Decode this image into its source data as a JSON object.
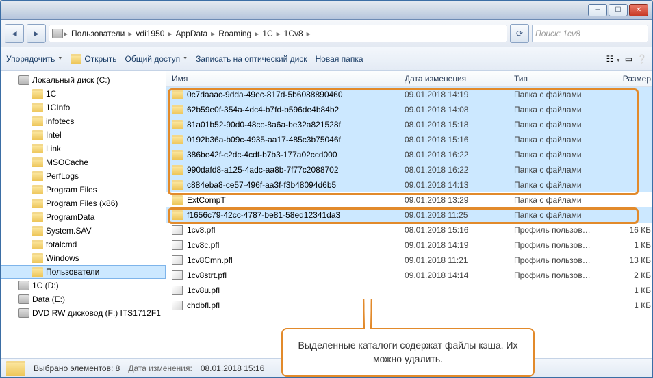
{
  "breadcrumbs": [
    "Пользователи",
    "vdi1950",
    "AppData",
    "Roaming",
    "1C",
    "1Cv8"
  ],
  "search_placeholder": "Поиск: 1cv8",
  "toolbar": {
    "organize": "Упорядочить",
    "open": "Открыть",
    "share": "Общий доступ",
    "burn": "Записать на оптический диск",
    "newfolder": "Новая папка"
  },
  "tree": [
    {
      "label": "Локальный диск (C:)",
      "icon": "drive",
      "depth": 0
    },
    {
      "label": "1C",
      "icon": "folder",
      "depth": 1
    },
    {
      "label": "1CInfo",
      "icon": "folder",
      "depth": 1
    },
    {
      "label": "infotecs",
      "icon": "folder",
      "depth": 1
    },
    {
      "label": "Intel",
      "icon": "folder",
      "depth": 1
    },
    {
      "label": "Link",
      "icon": "folder",
      "depth": 1
    },
    {
      "label": "MSOCache",
      "icon": "folder",
      "depth": 1
    },
    {
      "label": "PerfLogs",
      "icon": "folder",
      "depth": 1
    },
    {
      "label": "Program Files",
      "icon": "folder",
      "depth": 1
    },
    {
      "label": "Program Files (x86)",
      "icon": "folder",
      "depth": 1
    },
    {
      "label": "ProgramData",
      "icon": "folder",
      "depth": 1
    },
    {
      "label": "System.SAV",
      "icon": "folder",
      "depth": 1
    },
    {
      "label": "totalcmd",
      "icon": "folder",
      "depth": 1
    },
    {
      "label": "Windows",
      "icon": "folder",
      "depth": 1
    },
    {
      "label": "Пользователи",
      "icon": "folder",
      "depth": 1,
      "selected": true
    },
    {
      "label": "1C (D:)",
      "icon": "drive",
      "depth": 0
    },
    {
      "label": "Data (E:)",
      "icon": "drive",
      "depth": 0
    },
    {
      "label": "DVD RW дисковод (F:) ITS1712F1",
      "icon": "drive",
      "depth": 0
    }
  ],
  "columns": {
    "name": "Имя",
    "date": "Дата изменения",
    "type": "Тип",
    "size": "Размер"
  },
  "rows": [
    {
      "name": "0c7daaac-9dda-49ec-817d-5b6088890460",
      "date": "09.01.2018 14:19",
      "type": "Папка с файлами",
      "size": "",
      "icon": "folder",
      "sel": true
    },
    {
      "name": "62b59e0f-354a-4dc4-b7fd-b596de4b84b2",
      "date": "09.01.2018 14:08",
      "type": "Папка с файлами",
      "size": "",
      "icon": "folder",
      "sel": true
    },
    {
      "name": "81a01b52-90d0-48cc-8a6a-be32a821528f",
      "date": "08.01.2018 15:18",
      "type": "Папка с файлами",
      "size": "",
      "icon": "folder",
      "sel": true
    },
    {
      "name": "0192b36a-b09c-4935-aa17-485c3b75046f",
      "date": "08.01.2018 15:16",
      "type": "Папка с файлами",
      "size": "",
      "icon": "folder",
      "sel": true
    },
    {
      "name": "386be42f-c2dc-4cdf-b7b3-177a02ccd000",
      "date": "08.01.2018 16:22",
      "type": "Папка с файлами",
      "size": "",
      "icon": "folder",
      "sel": true
    },
    {
      "name": "990dafd8-a125-4adc-aa8b-7f77c2088702",
      "date": "08.01.2018 16:22",
      "type": "Папка с файлами",
      "size": "",
      "icon": "folder",
      "sel": true
    },
    {
      "name": "c884eba8-ce57-496f-aa3f-f3b48094d6b5",
      "date": "09.01.2018 14:13",
      "type": "Папка с файлами",
      "size": "",
      "icon": "folder",
      "sel": true
    },
    {
      "name": "ExtCompT",
      "date": "09.01.2018 13:29",
      "type": "Папка с файлами",
      "size": "",
      "icon": "folder",
      "sel": false
    },
    {
      "name": "f1656c79-42cc-4787-be81-58ed12341da3",
      "date": "09.01.2018 11:25",
      "type": "Папка с файлами",
      "size": "",
      "icon": "folder",
      "sel": true
    },
    {
      "name": "1cv8.pfl",
      "date": "08.01.2018 15:16",
      "type": "Профиль пользов…",
      "size": "16 КБ",
      "icon": "file",
      "sel": false
    },
    {
      "name": "1cv8c.pfl",
      "date": "09.01.2018 14:19",
      "type": "Профиль пользов…",
      "size": "1 КБ",
      "icon": "file",
      "sel": false
    },
    {
      "name": "1cv8Cmn.pfl",
      "date": "09.01.2018 11:21",
      "type": "Профиль пользов…",
      "size": "13 КБ",
      "icon": "file",
      "sel": false
    },
    {
      "name": "1cv8strt.pfl",
      "date": "09.01.2018 14:14",
      "type": "Профиль пользов…",
      "size": "2 КБ",
      "icon": "file",
      "sel": false
    },
    {
      "name": "1cv8u.pfl",
      "date": "",
      "type": "",
      "size": "1 КБ",
      "icon": "file",
      "sel": false
    },
    {
      "name": "chdbfl.pfl",
      "date": "",
      "type": "",
      "size": "1 КБ",
      "icon": "file",
      "sel": false
    }
  ],
  "status": {
    "selected": "Выбрано элементов: 8",
    "datelabel": "Дата изменения:",
    "date": "08.01.2018 15:16"
  },
  "callout": "Выделенные каталоги содержат файлы кэша. Их можно удалить."
}
